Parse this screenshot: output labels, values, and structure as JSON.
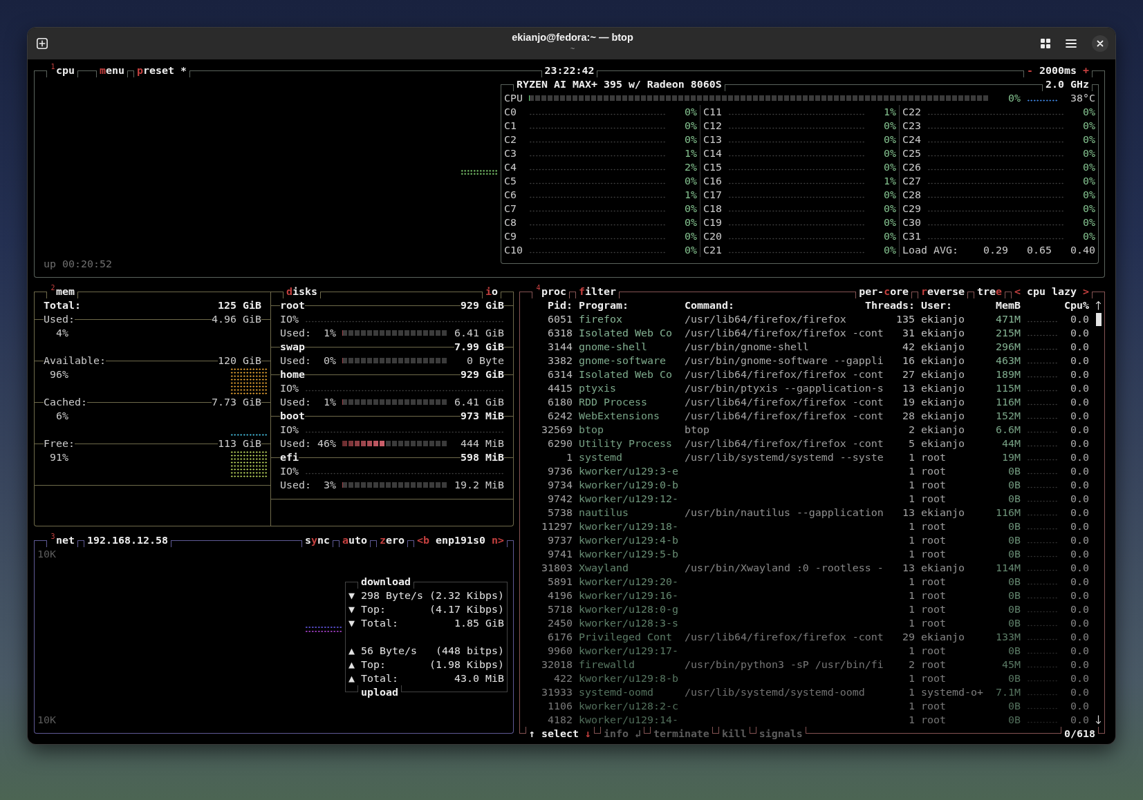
{
  "window": {
    "title": "ekianjo@fedora:~ — btop",
    "subtitle": "~"
  },
  "cpu": {
    "header_left": [
      "$^{1}$cpu",
      "**m**enu",
      "**p**reset *"
    ],
    "clock": "23:22:42",
    "header_right": [
      "**-** 2000ms **+**"
    ],
    "model": "RYZEN AI MAX+ 395 w/ Radeon 8060S",
    "frequency": "2.0 GHz",
    "total": {
      "label": "CPU",
      "level": 0,
      "reading": "0%",
      "temperature": "38°C"
    },
    "cores": [
      {
        "name": "C0",
        "reading": "0%"
      },
      {
        "name": "C1",
        "reading": "0%"
      },
      {
        "name": "C2",
        "reading": "0%"
      },
      {
        "name": "C3",
        "reading": "1%"
      },
      {
        "name": "C4",
        "reading": "2%"
      },
      {
        "name": "C5",
        "reading": "0%"
      },
      {
        "name": "C6",
        "reading": "1%"
      },
      {
        "name": "C7",
        "reading": "0%"
      },
      {
        "name": "C8",
        "reading": "0%"
      },
      {
        "name": "C9",
        "reading": "0%"
      },
      {
        "name": "C10",
        "reading": "0%"
      },
      {
        "name": "C11",
        "reading": "1%"
      },
      {
        "name": "C12",
        "reading": "0%"
      },
      {
        "name": "C13",
        "reading": "0%"
      },
      {
        "name": "C14",
        "reading": "0%"
      },
      {
        "name": "C15",
        "reading": "0%"
      },
      {
        "name": "C16",
        "reading": "1%"
      },
      {
        "name": "C17",
        "reading": "0%"
      },
      {
        "name": "C18",
        "reading": "0%"
      },
      {
        "name": "C19",
        "reading": "0%"
      },
      {
        "name": "C20",
        "reading": "0%"
      },
      {
        "name": "C21",
        "reading": "0%"
      },
      {
        "name": "C22",
        "reading": "0%"
      },
      {
        "name": "C23",
        "reading": "0%"
      },
      {
        "name": "C24",
        "reading": "0%"
      },
      {
        "name": "C25",
        "reading": "0%"
      },
      {
        "name": "C26",
        "reading": "0%"
      },
      {
        "name": "C27",
        "reading": "0%"
      },
      {
        "name": "C28",
        "reading": "0%"
      },
      {
        "name": "C29",
        "reading": "0%"
      },
      {
        "name": "C30",
        "reading": "0%"
      },
      {
        "name": "C31",
        "reading": "0%"
      }
    ],
    "load_avg": {
      "label": "Load AVG:",
      "values": [
        "0.29",
        "0.65",
        "0.40"
      ]
    },
    "uptime": "up 00:20:52"
  },
  "mem": {
    "title": "$^{2}$mem",
    "total": {
      "label": "Total:",
      "value": "125 GiB"
    },
    "stats": [
      {
        "label": "Used:",
        "value": "4.96 GiB",
        "percent": "4%"
      },
      {
        "label": "Available:",
        "value": "120 GiB",
        "percent": "96%",
        "color": "#eaa533",
        "level": 1
      },
      {
        "label": "Cached:",
        "value": "7.73 GiB",
        "percent": "6%",
        "color": "#44bfe0",
        "level": 0.125
      },
      {
        "label": "Free:",
        "value": "113 GiB",
        "percent": "91%",
        "color": "#bcd85e",
        "level": 1
      }
    ]
  },
  "disks": {
    "title": "**d**isks",
    "io_title": "**i**o",
    "items": [
      {
        "name": "root",
        "size": "929 GiB",
        "io_label": "IO%",
        "used_label": "Used:",
        "percent": "1%",
        "level": 0.01,
        "used": "6.41 GiB"
      },
      {
        "name": "swap",
        "size": "7.99 GiB",
        "used_label": "Used:",
        "percent": "0%",
        "level": 0,
        "used": "0 Byte"
      },
      {
        "name": "home",
        "size": "929 GiB",
        "io_label": "IO%",
        "used_label": "Used:",
        "percent": "1%",
        "level": 0.01,
        "used": "6.41 GiB"
      },
      {
        "name": "boot",
        "size": "973 MiB",
        "io_label": "IO%",
        "used_label": "Used:",
        "percent": "46%",
        "level": 0.46,
        "used": "444 MiB"
      },
      {
        "name": "efi",
        "size": "598 MiB",
        "io_label": "IO%",
        "used_label": "Used:",
        "percent": "3%",
        "level": 0.03,
        "used": "19.2 MiB"
      }
    ]
  },
  "net": {
    "title": "$^{3}$net",
    "address": "192.168.12.58",
    "header_right": [
      "s**y**nc",
      "**a**uto",
      "**z**ero",
      "**<b** enp191s0 **n>**"
    ],
    "scale_top": "10K",
    "scale_bottom": "10K",
    "download": {
      "title": "download",
      "rows": [
        {
          "label": "▼ 298 Byte/s",
          "value": "(2.32 Kibps)"
        },
        {
          "label": "▼ Top:",
          "value": "(4.17 Kibps)"
        },
        {
          "label": "▼ Total:",
          "value": "1.85 GiB"
        }
      ]
    },
    "upload": {
      "title": "upload",
      "rows": [
        {
          "label": "▲ 56 Byte/s",
          "value": "(448 bitps)"
        },
        {
          "label": "▲ Top:",
          "value": "(1.98 Kibps)"
        },
        {
          "label": "▲ Total:",
          "value": "43.0 MiB"
        }
      ]
    }
  },
  "proc": {
    "header_left": [
      "$^{4}$proc",
      "**f**ilter"
    ],
    "header_right": [
      "per-**c**ore",
      "**r**everse",
      "tre**e**",
      "**<** cpu lazy **>**"
    ],
    "columns": [
      "Pid:",
      "Program:",
      "Command:",
      "Threads:",
      "User:",
      "MemB",
      "Cpu%"
    ],
    "rows": [
      {
        "pid": "6051",
        "program": "firefox",
        "command": "/usr/lib64/firefox/firefox",
        "threads": "135",
        "user": "ekianjo",
        "mem": "471M",
        "cpu": "0.0"
      },
      {
        "pid": "6318",
        "program": "Isolated Web Co",
        "command": "/usr/lib64/firefox/firefox -cont",
        "threads": "31",
        "user": "ekianjo",
        "mem": "215M",
        "cpu": "0.0"
      },
      {
        "pid": "3144",
        "program": "gnome-shell",
        "command": "/usr/bin/gnome-shell",
        "threads": "42",
        "user": "ekianjo",
        "mem": "296M",
        "cpu": "0.0"
      },
      {
        "pid": "3382",
        "program": "gnome-software",
        "command": "/usr/bin/gnome-software --gappli",
        "threads": "16",
        "user": "ekianjo",
        "mem": "463M",
        "cpu": "0.0"
      },
      {
        "pid": "6314",
        "program": "Isolated Web Co",
        "command": "/usr/lib64/firefox/firefox -cont",
        "threads": "27",
        "user": "ekianjo",
        "mem": "189M",
        "cpu": "0.0"
      },
      {
        "pid": "4415",
        "program": "ptyxis",
        "command": "/usr/bin/ptyxis --gapplication-s",
        "threads": "13",
        "user": "ekianjo",
        "mem": "115M",
        "cpu": "0.0"
      },
      {
        "pid": "6180",
        "program": "RDD Process",
        "command": "/usr/lib64/firefox/firefox -cont",
        "threads": "19",
        "user": "ekianjo",
        "mem": "116M",
        "cpu": "0.0"
      },
      {
        "pid": "6242",
        "program": "WebExtensions",
        "command": "/usr/lib64/firefox/firefox -cont",
        "threads": "28",
        "user": "ekianjo",
        "mem": "152M",
        "cpu": "0.0"
      },
      {
        "pid": "32569",
        "program": "btop",
        "command": "btop",
        "threads": "2",
        "user": "ekianjo",
        "mem": "6.6M",
        "cpu": "0.0"
      },
      {
        "pid": "6290",
        "program": "Utility Process",
        "command": "/usr/lib64/firefox/firefox -cont",
        "threads": "5",
        "user": "ekianjo",
        "mem": "44M",
        "cpu": "0.0"
      },
      {
        "pid": "1",
        "program": "systemd",
        "command": "/usr/lib/systemd/systemd --syste",
        "threads": "1",
        "user": "root",
        "mem": "19M",
        "cpu": "0.0"
      },
      {
        "pid": "9736",
        "program": "kworker/u129:3-e",
        "threads": "1",
        "user": "root",
        "mem": "0B",
        "cpu": "0.0"
      },
      {
        "pid": "9734",
        "program": "kworker/u129:0-b",
        "threads": "1",
        "user": "root",
        "mem": "0B",
        "cpu": "0.0"
      },
      {
        "pid": "9742",
        "program": "kworker/u129:12-",
        "threads": "1",
        "user": "root",
        "mem": "0B",
        "cpu": "0.0"
      },
      {
        "pid": "5738",
        "program": "nautilus",
        "command": "/usr/bin/nautilus --gapplication",
        "threads": "13",
        "user": "ekianjo",
        "mem": "116M",
        "cpu": "0.0"
      },
      {
        "pid": "11297",
        "program": "kworker/u129:18-",
        "threads": "1",
        "user": "root",
        "mem": "0B",
        "cpu": "0.0"
      },
      {
        "pid": "9737",
        "program": "kworker/u129:4-b",
        "threads": "1",
        "user": "root",
        "mem": "0B",
        "cpu": "0.0"
      },
      {
        "pid": "9741",
        "program": "kworker/u129:5-b",
        "threads": "1",
        "user": "root",
        "mem": "0B",
        "cpu": "0.0"
      },
      {
        "pid": "31803",
        "program": "Xwayland",
        "command": "/usr/bin/Xwayland :0 -rootless -",
        "threads": "13",
        "user": "ekianjo",
        "mem": "114M",
        "cpu": "0.0"
      },
      {
        "pid": "5891",
        "program": "kworker/u129:20-",
        "threads": "1",
        "user": "root",
        "mem": "0B",
        "cpu": "0.0"
      },
      {
        "pid": "4196",
        "program": "kworker/u129:16-",
        "threads": "1",
        "user": "root",
        "mem": "0B",
        "cpu": "0.0"
      },
      {
        "pid": "5718",
        "program": "kworker/u128:0-g",
        "threads": "1",
        "user": "root",
        "mem": "0B",
        "cpu": "0.0"
      },
      {
        "pid": "2450",
        "program": "kworker/u128:3-s",
        "threads": "1",
        "user": "root",
        "mem": "0B",
        "cpu": "0.0"
      },
      {
        "pid": "6176",
        "program": "Privileged Cont",
        "command": "/usr/lib64/firefox/firefox -cont",
        "threads": "29",
        "user": "ekianjo",
        "mem": "133M",
        "cpu": "0.0"
      },
      {
        "pid": "9960",
        "program": "kworker/u129:17-",
        "threads": "1",
        "user": "root",
        "mem": "0B",
        "cpu": "0.0"
      },
      {
        "pid": "32018",
        "program": "firewalld",
        "command": "/usr/bin/python3 -sP /usr/bin/fi",
        "threads": "2",
        "user": "root",
        "mem": "45M",
        "cpu": "0.0"
      },
      {
        "pid": "422",
        "program": "kworker/u129:8-b",
        "threads": "1",
        "user": "root",
        "mem": "0B",
        "cpu": "0.0"
      },
      {
        "pid": "31933",
        "program": "systemd-oomd",
        "command": "/usr/lib/systemd/systemd-oomd",
        "threads": "1",
        "user": "systemd-o+",
        "mem": "7.1M",
        "cpu": "0.0"
      },
      {
        "pid": "1106",
        "program": "kworker/u128:2-c",
        "threads": "1",
        "user": "root",
        "mem": "0B",
        "cpu": "0.0"
      },
      {
        "pid": "4182",
        "program": "kworker/u129:14-",
        "threads": "1",
        "user": "root",
        "mem": "0B",
        "cpu": "0.0"
      }
    ],
    "footer": [
      {
        "text": "↑ select **↓**",
        "disabled": false
      },
      {
        "text": "info ↲",
        "disabled": true
      },
      {
        "text": "terminate",
        "disabled": true
      },
      {
        "text": "kill",
        "disabled": true
      },
      {
        "text": "signals",
        "disabled": true
      }
    ],
    "count": "0/618"
  }
}
